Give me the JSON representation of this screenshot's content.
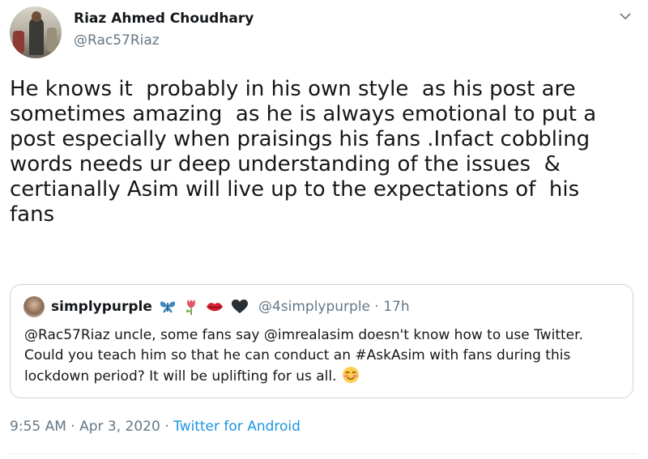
{
  "author": {
    "name": "Riaz Ahmed Choudhary",
    "handle": "@Rac57Riaz"
  },
  "tweet": {
    "text": "He knows it  probably in his own style  as his post are\nsometimes amazing  as he is always emotional to put a\npost especially when praisings his fans .Infact cobbling\nwords needs ur deep understanding of the issues  &\ncertianally Asim will live up to the expectations of  his\nfans"
  },
  "quoted": {
    "name": "simplypurple",
    "emoji_icons": [
      "butterfly-icon",
      "tulip-icon",
      "lips-icon",
      "black-heart-icon"
    ],
    "handle": "@4simplypurple",
    "time": "17h",
    "text": "@Rac57Riaz uncle, some fans say @imrealasim doesn't know how to use Twitter.\nCould you teach him so that he can conduct an #AskAsim with fans during this\nlockdown period? It will be uplifting for us all."
  },
  "meta": {
    "time": "9:55 AM",
    "date": "Apr 3, 2020",
    "source": "Twitter for Android",
    "separator": "·"
  },
  "colors": {
    "text": "#14171a",
    "secondary": "#657786",
    "link": "#1b95e0",
    "border": "#ccd6dd"
  }
}
